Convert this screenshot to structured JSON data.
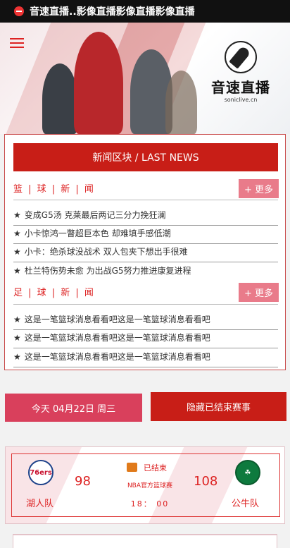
{
  "topbar": {
    "title": "音速直播..影像直播影像直播影像直播",
    "icon": "arrow-right-icon"
  },
  "header": {
    "menu_icon": "hamburger-menu-icon",
    "logo_text": "音速直播",
    "logo_sub": "soniclive.cn"
  },
  "news": {
    "title": "新闻区块 / LAST NEWS",
    "basketball": {
      "label": "篮 | 球 | 新 | 闻",
      "more": "+ 更多",
      "items": [
        "变成G5汤 克莱最后两记三分力挽狂澜",
        "小卡惊鸿一瞥超巨本色 却难填手感低潮",
        "小卡：绝杀球没战术 双人包夹下想出手很难",
        "杜兰特伤势未愈 为出战G5努力推进康复进程"
      ]
    },
    "football": {
      "label": "足 | 球 | 新 | 闻",
      "more": "+ 更多",
      "items": [
        "这是一笔篮球消息看看吧这是一笔篮球消息看看吧",
        "这是一笔篮球消息看看吧这是一笔篮球消息看看吧",
        "这是一笔篮球消息看看吧这是一笔篮球消息看看吧"
      ]
    }
  },
  "schedule": {
    "date_label": "今天 04月22日 周三",
    "hide_button": "隐藏已结束赛事"
  },
  "match": {
    "home": {
      "name": "湖人队",
      "score": "98",
      "logo": "76ers"
    },
    "away": {
      "name": "公牛队",
      "score": "108"
    },
    "status": "已结束",
    "league": "NBA官方篮球赛",
    "time": "18： 00"
  }
}
